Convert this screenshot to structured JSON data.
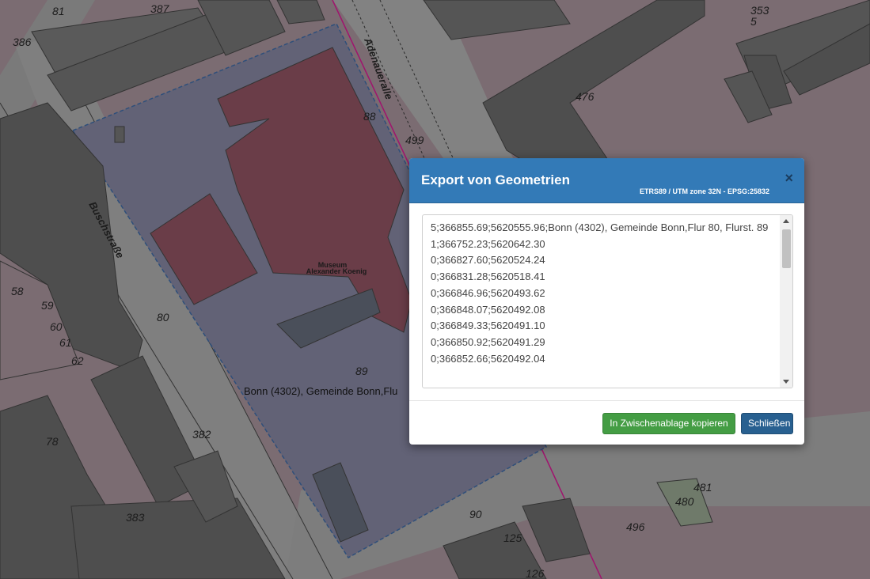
{
  "map": {
    "street_labels": [
      "Adenaueralle",
      "Buschstraße"
    ],
    "building_label_line1": "Museum",
    "building_label_line2": "Alexander Koenig",
    "parcel_label": "Bonn (4302), Gemeinde Bonn,Flu",
    "numbers": [
      "387",
      "386",
      "81",
      "353",
      "5",
      "476",
      "88",
      "499",
      "80",
      "89",
      "58",
      "59",
      "60",
      "61",
      "62",
      "78",
      "382",
      "383",
      "90",
      "481",
      "480",
      "496",
      "125",
      "126"
    ]
  },
  "dialog": {
    "title": "Export von Geometrien",
    "crs": "ETRS89 / UTM zone 32N - EPSG:25832",
    "close_symbol": "×",
    "lines": [
      "5;366855.69;5620555.96;Bonn (4302), Gemeinde Bonn,Flur 80, Flurst. 89",
      "1;366752.23;5620642.30",
      "0;366827.60;5620524.24",
      "0;366831.28;5620518.41",
      "0;366846.96;5620493.62",
      "0;366848.07;5620492.08",
      "0;366849.33;5620491.10",
      "0;366850.92;5620491.29",
      "0;366852.66;5620492.04"
    ],
    "copy_label": "In Zwischenablage kopieren",
    "close_label": "Schließen"
  },
  "colors": {
    "header": "#337ab7",
    "copy_button": "#449d44",
    "close_button": "#286090",
    "building": "#4e4e4e",
    "museum": "#6a3d48",
    "parcel": "#626276"
  }
}
